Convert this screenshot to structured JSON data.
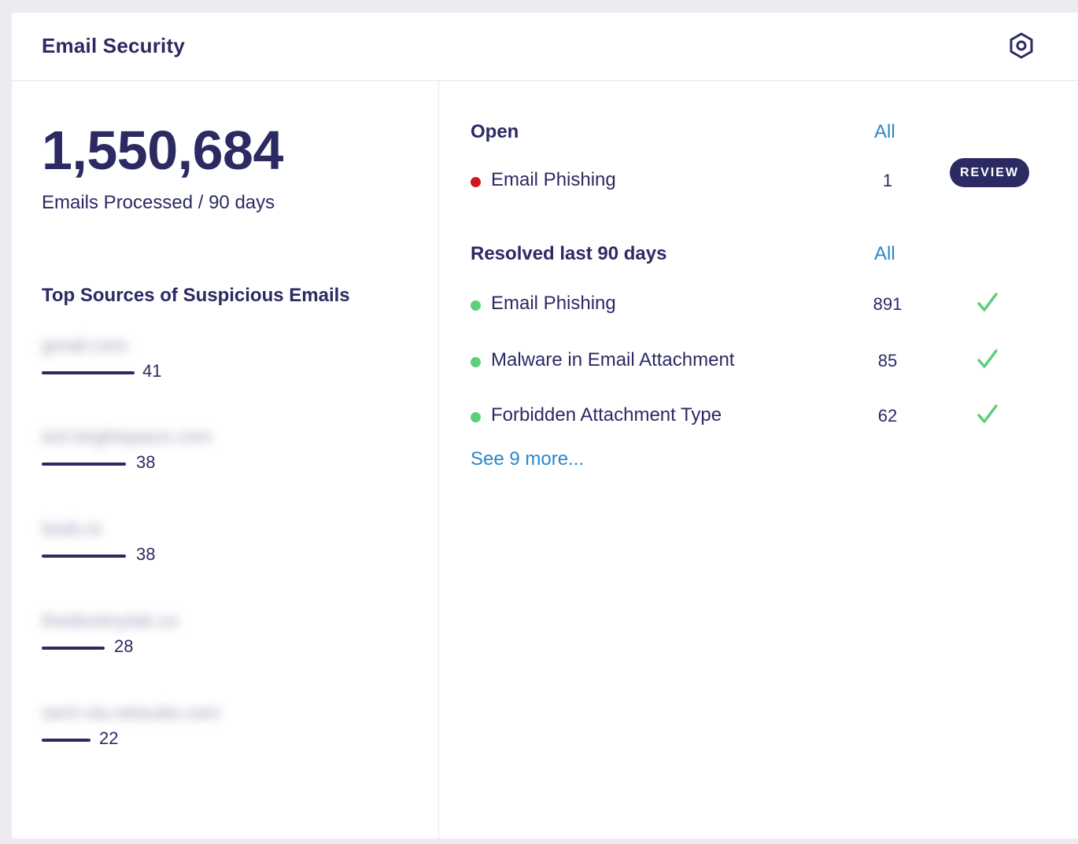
{
  "header": {
    "title": "Email Security",
    "settings_icon": "hexagon-settings-icon"
  },
  "summary": {
    "total": "1,550,684",
    "caption": "Emails Processed / 90 days"
  },
  "top_sources": {
    "title": "Top Sources of Suspicious Emails",
    "items": [
      {
        "domain": "gmail.com",
        "count": "41",
        "value": 41
      },
      {
        "domain": "ta3.brightspace.com",
        "count": "38",
        "value": 38
      },
      {
        "domain": "bsds.io",
        "count": "38",
        "value": 38
      },
      {
        "domain": "thedestinylab.co",
        "count": "28",
        "value": 28
      },
      {
        "domain": "sent-via.netsuite.com",
        "count": "22",
        "value": 22
      }
    ]
  },
  "open": {
    "label": "Open",
    "all_link": "All",
    "rows": [
      {
        "label": "Email Phishing",
        "count": "1",
        "status_color": "#d0161d",
        "action": "REVIEW"
      }
    ]
  },
  "resolved": {
    "label": "Resolved last 90 days",
    "all_link": "All",
    "rows": [
      {
        "label": "Email Phishing",
        "count": "891",
        "status_color": "#5ccf7b",
        "icon": "checkmark-icon"
      },
      {
        "label": "Malware in Email Attachment",
        "count": "85",
        "status_color": "#5ccf7b",
        "icon": "checkmark-icon"
      },
      {
        "label": "Forbidden Attachment Type",
        "count": "62",
        "status_color": "#5ccf7b",
        "icon": "checkmark-icon"
      }
    ],
    "see_more": "See 9 more..."
  },
  "colors": {
    "brand": "#2b2a63",
    "link": "#2a86c9",
    "open_status": "#d0161d",
    "resolved_status": "#5ccf7b"
  }
}
